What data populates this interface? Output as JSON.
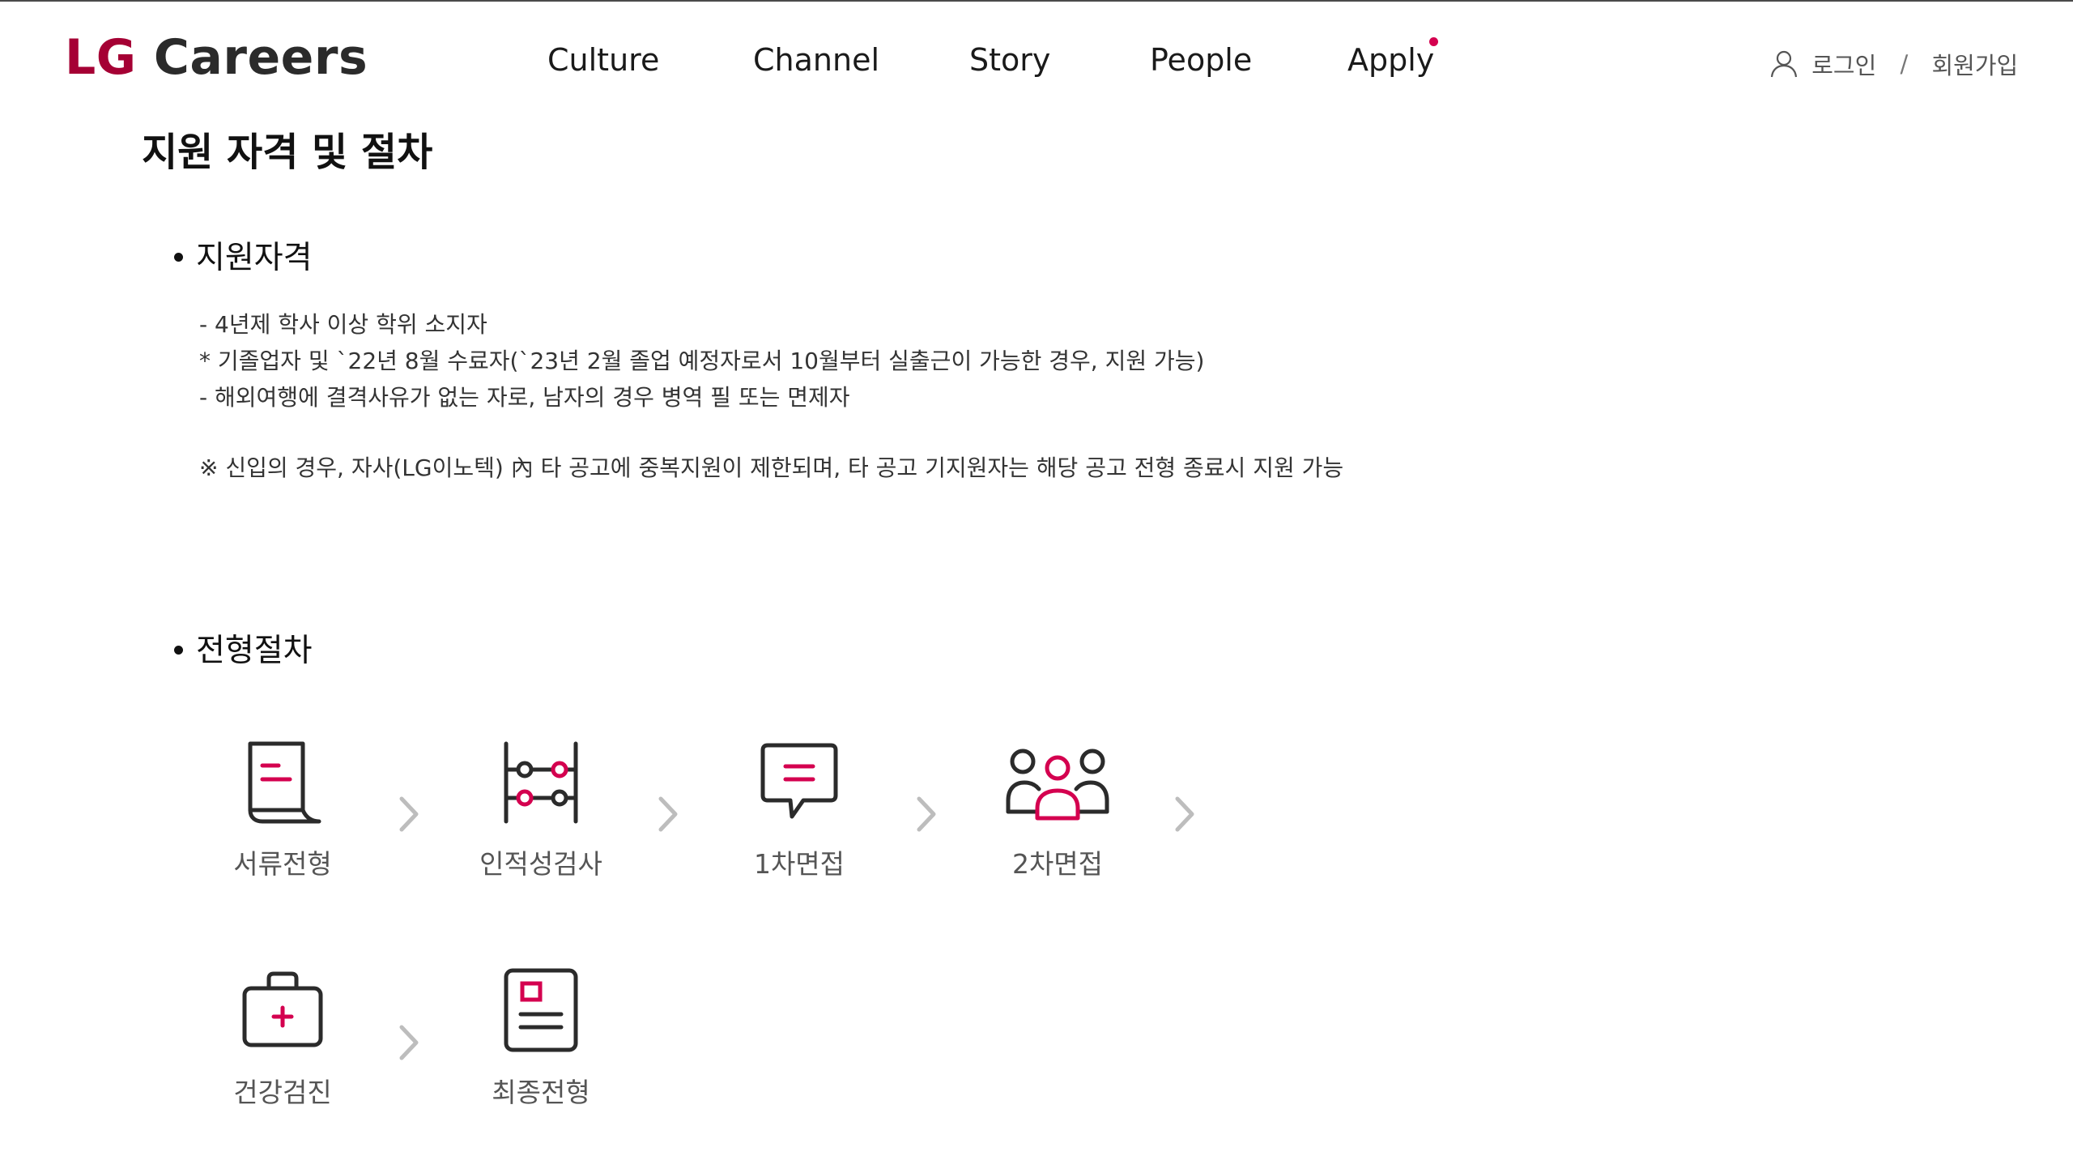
{
  "header": {
    "logo_lg": "LG",
    "logo_careers": "Careers",
    "nav": [
      {
        "label": "Culture"
      },
      {
        "label": "Channel"
      },
      {
        "label": "Story"
      },
      {
        "label": "People"
      },
      {
        "label": "Apply"
      }
    ],
    "login": "로그인",
    "separator": "/",
    "signup": "회원가입"
  },
  "colors": {
    "brand": "#a50034",
    "accent_icon": "#d4004f",
    "icon_dark": "#2b2b2b"
  },
  "page": {
    "title": "지원 자격 및 절차"
  },
  "qualification": {
    "heading": "지원자격",
    "lines": [
      "- 4년제 학사 이상 학위 소지자",
      "* 기졸업자 및 `22년 8월 수료자(`23년 2월 졸업 예정자로서 10월부터 실출근이 가능한 경우, 지원 가능)",
      "- 해외여행에 결격사유가 없는 자로, 남자의 경우 병역 필 또는 면제자"
    ],
    "note": "※ 신입의 경우, 자사(LG이노텍) 內 타 공고에 중복지원이 제한되며, 타 공고 기지원자는 해당 공고 전형 종료시 지원 가능"
  },
  "process": {
    "heading": "전형절차",
    "steps": [
      {
        "label": "서류전형",
        "icon": "document-icon"
      },
      {
        "label": "인적성검사",
        "icon": "abacus-icon"
      },
      {
        "label": "1차면접",
        "icon": "speech-bubble-icon"
      },
      {
        "label": "2차면접",
        "icon": "group-people-icon"
      },
      {
        "label": "건강검진",
        "icon": "medical-kit-icon"
      },
      {
        "label": "최종전형",
        "icon": "profile-card-icon"
      }
    ]
  }
}
